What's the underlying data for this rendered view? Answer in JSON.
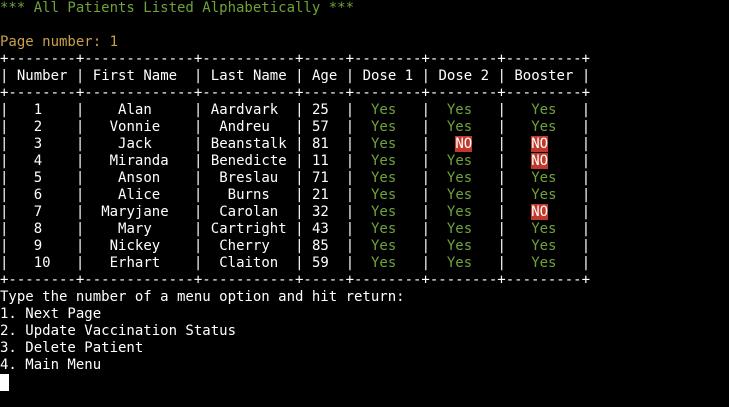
{
  "colors": {
    "background": "#000000",
    "text": "#ffffff",
    "title": "#6fa33a",
    "page_number": "#c8a14a",
    "yes": "#6fa33a",
    "no_bg": "#c0392b"
  },
  "title": "*** All Patients Listed Alphabetically ***",
  "page_number_text": "Page number: 1",
  "table": {
    "border_line": "+--------+-------------+-----------+-----+--------+--------+---------+",
    "headers": [
      "Number",
      "First Name",
      "Last Name",
      "Age",
      "Dose 1",
      "Dose 2",
      "Booster"
    ],
    "rows": [
      [
        "1",
        "Alan",
        "Aardvark",
        "25",
        "Yes",
        "Yes",
        "Yes"
      ],
      [
        "2",
        "Vonnie",
        "Andreu",
        "57",
        "Yes",
        "Yes",
        "Yes"
      ],
      [
        "3",
        "Jack",
        "Beanstalk",
        "81",
        "Yes",
        "NO",
        "NO"
      ],
      [
        "4",
        "Miranda",
        "Benedicte",
        "11",
        "Yes",
        "Yes",
        "NO"
      ],
      [
        "5",
        "Anson",
        "Breslau",
        "71",
        "Yes",
        "Yes",
        "Yes"
      ],
      [
        "6",
        "Alice",
        "Burns",
        "21",
        "Yes",
        "Yes",
        "Yes"
      ],
      [
        "7",
        "Maryjane",
        "Carolan",
        "32",
        "Yes",
        "Yes",
        "NO"
      ],
      [
        "8",
        "Mary",
        "Cartright",
        "43",
        "Yes",
        "Yes",
        "Yes"
      ],
      [
        "9",
        "Nickey",
        "Cherry",
        "85",
        "Yes",
        "Yes",
        "Yes"
      ],
      [
        "10",
        "Erhart",
        "Claiton",
        "59",
        "Yes",
        "Yes",
        "Yes"
      ]
    ]
  },
  "menu": {
    "prompt": "Type the number of a menu option and hit return:",
    "options": [
      "1. Next Page",
      "2. Update Vaccination Status",
      "3. Delete Patient",
      "4. Main Menu"
    ]
  }
}
